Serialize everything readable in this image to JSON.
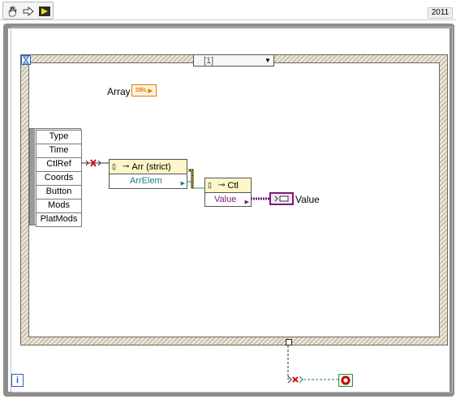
{
  "toolbar": {
    "tools": [
      "hand-icon",
      "arrow-icon",
      "run-icon"
    ],
    "version": "2011"
  },
  "event_structure": {
    "case_selector": "[1]"
  },
  "array_terminal": {
    "label": "Array",
    "type": "DBL"
  },
  "event_data_node": {
    "rows": [
      "Type",
      "Time",
      "CtlRef",
      "Coords",
      "Button",
      "Mods",
      "PlatMods"
    ]
  },
  "property_node_1": {
    "title": "Arr (strict)",
    "property": "ArrElem"
  },
  "property_node_2": {
    "title": "Ctl",
    "property": "Value"
  },
  "variant_output": {
    "label": "Value"
  },
  "loop": {
    "iteration_label": "i"
  }
}
